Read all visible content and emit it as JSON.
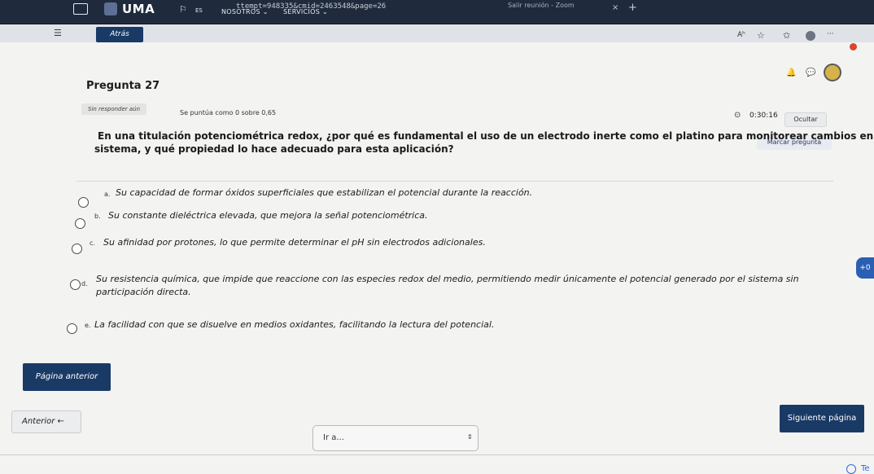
{
  "browser": {
    "url": "ttempt=948335&cmid=2463548&page=26",
    "zoom_label": "Salir reunión - Zoom",
    "tab_close": "×",
    "tab_new": "+"
  },
  "site": {
    "logo": "UMA",
    "lang": "ES",
    "nav": [
      "NOSOTROS ⌄",
      "SERVICIOS ⌄"
    ]
  },
  "toolbar": {
    "menu_glyph": "☰",
    "back_label": "Atrás",
    "read_glyph": "Aʰ",
    "fav_glyph": "☆",
    "collections_glyph": "✩",
    "more_glyph": "···",
    "bell_glyph": "🔔",
    "chat_glyph": "💬"
  },
  "quiz": {
    "title": "Pregunta 27",
    "status": "Sin responder aún",
    "score": "Se puntúa como 0 sobre 0,65",
    "timer": "0:30:16",
    "hide_label": "Ocultar",
    "flag_label": "Marcar pregunta",
    "question_line1": "En una titulación potenciométrica redox, ¿por qué es fundamental el uso de un electrodo inerte como el platino para monitorear cambios en el",
    "question_line2": "sistema, y qué propiedad lo hace adecuado para esta aplicación?",
    "options": [
      {
        "letter": "a.",
        "text": "Su capacidad de formar óxidos superficiales que estabilizan el potencial durante la reacción."
      },
      {
        "letter": "b.",
        "text": "Su constante dieléctrica elevada, que mejora la señal potenciométrica."
      },
      {
        "letter": "c.",
        "text": "Su afinidad por protones, lo que permite determinar el pH sin electrodos adicionales."
      },
      {
        "letter": "d.",
        "text": "Su resistencia química, que impide que reaccione con las especies redox del medio, permitiendo medir únicamente el potencial generado por el sistema sin",
        "text2": "participación directa."
      },
      {
        "letter": "e.",
        "text": "La facilidad con que se disuelve en medios oxidantes, facilitando la lectura del potencial."
      }
    ]
  },
  "footer": {
    "prev_page": "Página anterior",
    "prev_link": "Anterior ←",
    "goto_placeholder": "Ir a...",
    "goto_arrow": "⇕",
    "next_page": "Siguiente página",
    "corner_text": "Te",
    "side_pill": "+0"
  }
}
